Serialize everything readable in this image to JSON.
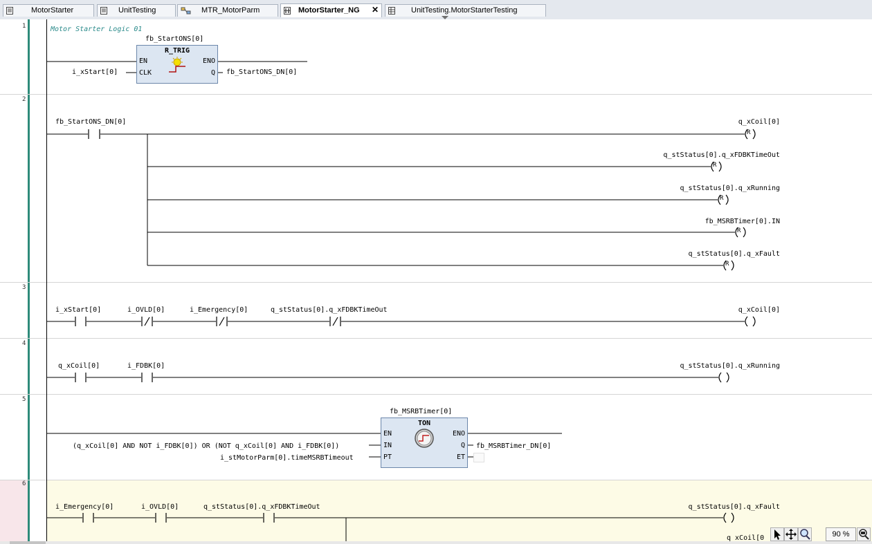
{
  "tabs": [
    {
      "label": "MotorStarter",
      "icon": "document-icon"
    },
    {
      "label": "UnitTesting",
      "icon": "document-icon"
    },
    {
      "label": "MTR_MotorParm",
      "icon": "struct-icon"
    },
    {
      "label": "MotorStarter_NG",
      "icon": "ladder-icon",
      "close": "✕"
    },
    {
      "label": "UnitTesting.MotorStarterTesting",
      "icon": "table-icon"
    }
  ],
  "networks": [
    {
      "number": "1",
      "comment": "Motor Starter Logic 01"
    },
    {
      "number": "2"
    },
    {
      "number": "3"
    },
    {
      "number": "4"
    },
    {
      "number": "5"
    },
    {
      "number": "6"
    }
  ],
  "net1": {
    "fb_instance": "fb_StartONS[0]",
    "fb_type": "R_TRIG",
    "pin_en": "EN",
    "pin_eno": "ENO",
    "pin_clk": "CLK",
    "pin_q": "Q",
    "in_clk": "i_xStart[0]",
    "out_q": "fb_StartONS_DN[0]"
  },
  "net2": {
    "contact": "fb_StartONS_DN[0]",
    "coils": [
      {
        "var": "q_xCoil[0]",
        "type": "R"
      },
      {
        "var": "q_stStatus[0].q_xFDBKTimeOut",
        "type": "R"
      },
      {
        "var": "q_stStatus[0].q_xRunning",
        "type": "R"
      },
      {
        "var": "fb_MSRBTimer[0].IN",
        "type": "R"
      },
      {
        "var": "q_stStatus[0].q_xFault",
        "type": "R"
      }
    ]
  },
  "net3": {
    "contacts": [
      {
        "var": "i_xStart[0]",
        "negated": false
      },
      {
        "var": "i_OVLD[0]",
        "negated": true
      },
      {
        "var": "i_Emergency[0]",
        "negated": true
      },
      {
        "var": "q_stStatus[0].q_xFDBKTimeOut",
        "negated": true
      }
    ],
    "coil": "q_xCoil[0]"
  },
  "net4": {
    "contacts": [
      {
        "var": "q_xCoil[0]",
        "negated": false
      },
      {
        "var": "i_FDBK[0]",
        "negated": false
      }
    ],
    "coil": "q_stStatus[0].q_xRunning"
  },
  "net5": {
    "fb_instance": "fb_MSRBTimer[0]",
    "fb_type": "TON",
    "pin_en": "EN",
    "pin_eno": "ENO",
    "pin_in": "IN",
    "pin_q": "Q",
    "pin_pt": "PT",
    "pin_et": "ET",
    "in_expr": "(q_xCoil[0] AND NOT i_FDBK[0]) OR (NOT q_xCoil[0] AND i_FDBK[0])",
    "pt_expr": "i_stMotorParm[0].timeMSRBTimeout",
    "out_q": "fb_MSRBTimer_DN[0]"
  },
  "net6": {
    "contacts": [
      {
        "var": "i_Emergency[0]",
        "negated": false
      },
      {
        "var": "i_OVLD[0]",
        "negated": false
      },
      {
        "var": "q_stStatus[0].q_xFDBKTimeOut",
        "negated": false
      }
    ],
    "coil": "q_stStatus[0].q_xFault",
    "branch_coil_partial": "q_xCoil[0"
  },
  "statusbar": {
    "zoom": "90 %"
  },
  "colors": {
    "fb_fill": "#dce6f2",
    "comment": "#2a8a8a",
    "selected_network_bg": "#fdfbe6"
  }
}
